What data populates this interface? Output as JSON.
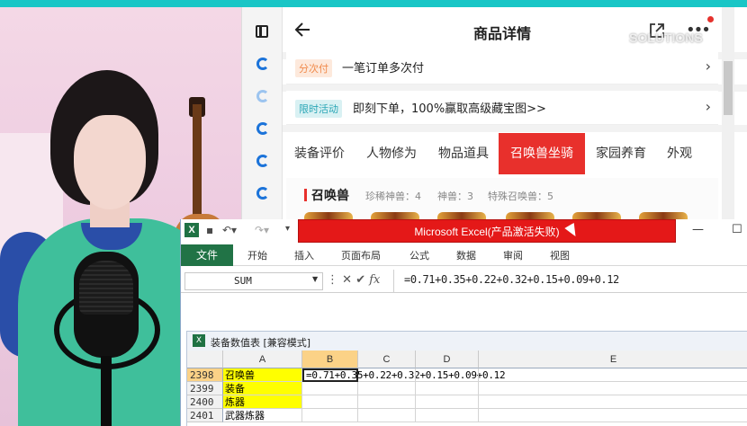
{
  "stream": {
    "top_text": "",
    "accent_color": "#19c6c6"
  },
  "browser_sidebar": {
    "icons": [
      "tabs-icon",
      "browser-icon",
      "browser-icon",
      "browser-icon",
      "browser-icon",
      "browser-icon"
    ]
  },
  "product_page": {
    "title": "商品详情",
    "watermark": "SOLUTIONS",
    "rows": [
      {
        "tag": "分次付",
        "text": "一笔订单多次付"
      },
      {
        "tag": "限时活动",
        "text": "即刻下单，100%赢取高级藏宝图>>"
      }
    ],
    "tabs": [
      "装备评价",
      "人物修为",
      "物品道具",
      "召唤兽坐骑",
      "家园养育",
      "外观"
    ],
    "active_tab": "召唤兽坐骑",
    "summon": {
      "title": "召唤兽",
      "stats": [
        "珍稀神兽：4",
        "神兽：3",
        "特殊召唤兽：5"
      ]
    },
    "colors": {
      "active_tab": "#e8302c",
      "tag_orange": "#f08a4b",
      "tag_teal": "#2aa6b6"
    }
  },
  "excel": {
    "title": "Microsoft Excel(产品激活失败)",
    "ribbon_tabs": [
      "文件",
      "开始",
      "插入",
      "页面布局",
      "公式",
      "数据",
      "审阅",
      "视图"
    ],
    "name_box": "SUM",
    "fx_label": "fx",
    "formula": "=0.71+0.35+0.22+0.32+0.15+0.09+0.12",
    "workbook_title": "装备数值表 [兼容模式]",
    "columns": [
      "A",
      "B",
      "C",
      "D",
      "E"
    ],
    "rows": [
      {
        "num": "2398",
        "a": "召唤兽",
        "b": "=0.71+0.35+0.22+0.32+0.15+0.09+0.12"
      },
      {
        "num": "2399",
        "a": "装备",
        "b": ""
      },
      {
        "num": "2400",
        "a": "炼器",
        "b": ""
      },
      {
        "num": "2401",
        "a": "武器炼器",
        "b": ""
      }
    ],
    "colors": {
      "file_tab": "#217346",
      "title_bar": "#e41818",
      "highlight": "#ffff00",
      "selected_header": "#fbd287"
    }
  }
}
